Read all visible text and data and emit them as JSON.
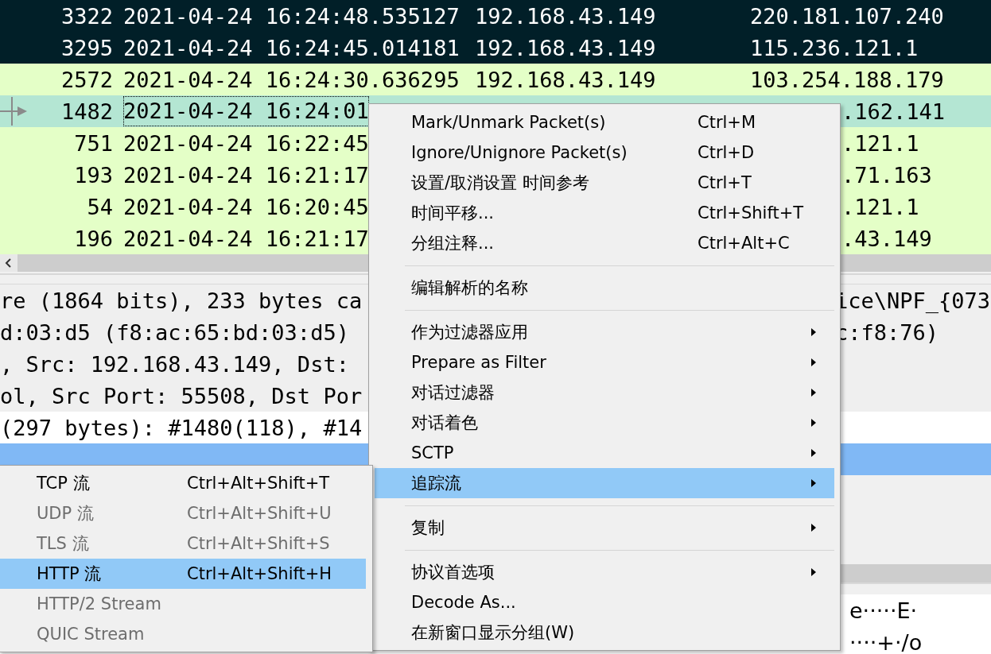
{
  "packet_list": {
    "rows": [
      {
        "no": "3322",
        "time": "2021-04-24 16:24:48.535127",
        "source": "192.168.43.149",
        "destination": "220.181.107.240",
        "color": "#011f28",
        "selected": false
      },
      {
        "no": "3295",
        "time": "2021-04-24 16:24:45.014181",
        "source": "192.168.43.149",
        "destination": "115.236.121.1",
        "color": "#011f28",
        "selected": false
      },
      {
        "no": "2572",
        "time": "2021-04-24 16:24:30.636295",
        "source": "192.168.43.149",
        "destination": "103.254.188.179",
        "color": "#e4ffc7",
        "selected": false
      },
      {
        "no": "1482",
        "time": "2021-04-24 16:24:01",
        "destination": ".162.141",
        "selected": true
      },
      {
        "no": "751",
        "time": "2021-04-24 16:22:45",
        "destination": ".121.1",
        "color": "#e4ffc7",
        "selected": false
      },
      {
        "no": "193",
        "time": "2021-04-24 16:21:17",
        "destination": ".71.163",
        "color": "#e4ffc7",
        "selected": false
      },
      {
        "no": "54",
        "time": "2021-04-24 16:20:45",
        "destination": ".121.1",
        "color": "#e4ffc7",
        "selected": false
      },
      {
        "no": "196",
        "time": "2021-04-24 16:21:17",
        "destination": ".43.149",
        "color": "#e4ffc7",
        "selected": false
      }
    ]
  },
  "details": {
    "lines": [
      {
        "left": "re (1864 bits), 233 bytes ca",
        "right": "ice\\NPF_{073",
        "selected": false,
        "hovered": false
      },
      {
        "left": "d:03:d5 (f8:ac:65:bd:03:d5)",
        "right": "c:f8:76)",
        "selected": false,
        "hovered": false
      },
      {
        "left": ", Src: 192.168.43.149, Dst:",
        "selected": false,
        "hovered": false
      },
      {
        "left": "ol, Src Port: 55508, Dst Por",
        "selected": false,
        "hovered": false
      },
      {
        "left": "(297 bytes): #1480(118), #14",
        "selected": false,
        "hovered": true
      },
      {
        "selected": true
      }
    ]
  },
  "bytes": {
    "lines": [
      "e·····E·",
      "····+·/o"
    ]
  },
  "context_menu": {
    "items": [
      {
        "kind": "item",
        "label": "Mark/Unmark Packet(s)",
        "shortcut": "Ctrl+M",
        "submenu": false,
        "selected": false
      },
      {
        "kind": "item",
        "label": "Ignore/Unignore Packet(s)",
        "shortcut": "Ctrl+D",
        "submenu": false,
        "selected": false
      },
      {
        "kind": "item",
        "label": "设置/取消设置 时间参考",
        "shortcut": "Ctrl+T",
        "submenu": false,
        "selected": false
      },
      {
        "kind": "item",
        "label": "时间平移...",
        "shortcut": "Ctrl+Shift+T",
        "submenu": false,
        "selected": false
      },
      {
        "kind": "item",
        "label": "分组注释...",
        "shortcut": "Ctrl+Alt+C",
        "submenu": false,
        "selected": false
      },
      {
        "kind": "separator"
      },
      {
        "kind": "item",
        "label": "编辑解析的名称",
        "submenu": false,
        "selected": false
      },
      {
        "kind": "separator"
      },
      {
        "kind": "item",
        "label": "作为过滤器应用",
        "submenu": true,
        "selected": false
      },
      {
        "kind": "item",
        "label": "Prepare as Filter",
        "submenu": true,
        "selected": false
      },
      {
        "kind": "item",
        "label": "对话过滤器",
        "submenu": true,
        "selected": false
      },
      {
        "kind": "item",
        "label": "对话着色",
        "submenu": true,
        "selected": false
      },
      {
        "kind": "item",
        "label": "SCTP",
        "submenu": true,
        "selected": false
      },
      {
        "kind": "item",
        "label": "追踪流",
        "submenu": true,
        "selected": true
      },
      {
        "kind": "separator"
      },
      {
        "kind": "item",
        "label": "复制",
        "submenu": true,
        "selected": false
      },
      {
        "kind": "separator"
      },
      {
        "kind": "item",
        "label": "协议首选项",
        "submenu": true,
        "selected": false
      },
      {
        "kind": "item",
        "label": "Decode As...",
        "submenu": false,
        "selected": false
      },
      {
        "kind": "item",
        "label": "在新窗口显示分组(W)",
        "submenu": false,
        "selected": false
      }
    ]
  },
  "follow_submenu": {
    "items": [
      {
        "label": "TCP 流",
        "shortcut": "Ctrl+Alt+Shift+T",
        "disabled": false,
        "selected": false
      },
      {
        "label": "UDP 流",
        "shortcut": "Ctrl+Alt+Shift+U",
        "disabled": true,
        "selected": false
      },
      {
        "label": "TLS 流",
        "shortcut": "Ctrl+Alt+Shift+S",
        "disabled": true,
        "selected": false
      },
      {
        "label": "HTTP 流",
        "shortcut": "Ctrl+Alt+Shift+H",
        "disabled": false,
        "selected": true
      },
      {
        "label": "HTTP/2 Stream",
        "disabled": true,
        "selected": false
      },
      {
        "label": "QUIC Stream",
        "disabled": true,
        "selected": false
      }
    ]
  }
}
